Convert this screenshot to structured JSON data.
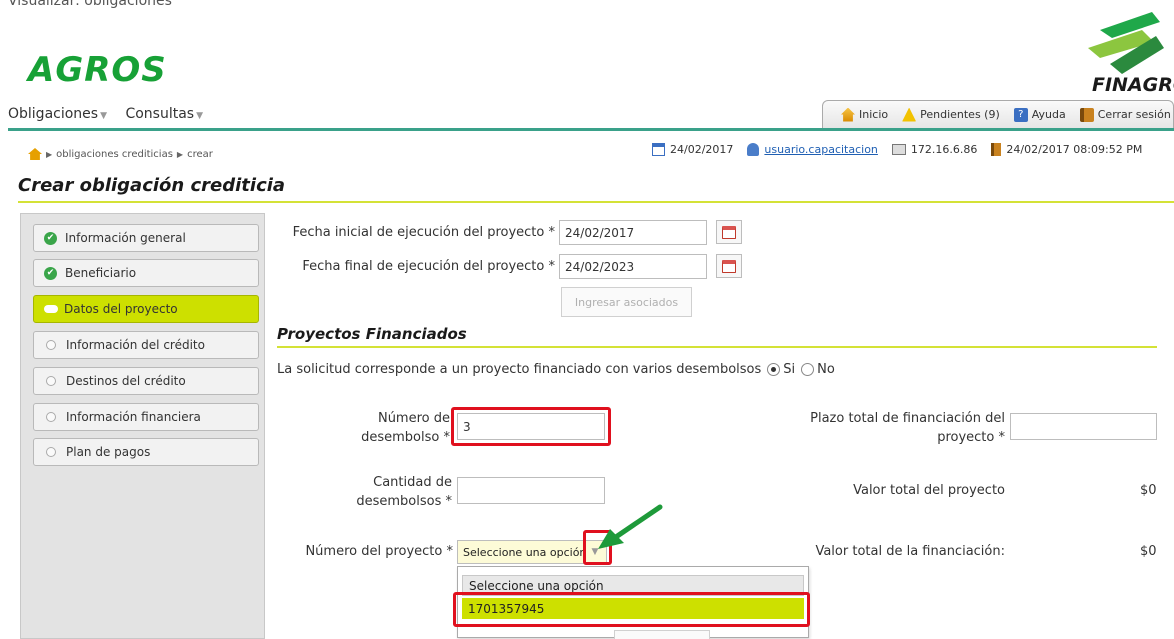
{
  "top_cut_text": "Visualizar: obligaciones",
  "brand": {
    "app_logo": "AGROS",
    "partner_logo": "FINAGRO"
  },
  "menu": {
    "items": [
      {
        "label": "Obligaciones"
      },
      {
        "label": "Consultas"
      }
    ]
  },
  "toolbar": {
    "items": [
      {
        "label": "Inicio",
        "icon": "home-icon",
        "color": "#e6a000"
      },
      {
        "label": "Pendientes (9)",
        "icon": "warning-icon",
        "color": "#f2c200"
      },
      {
        "label": "Ayuda",
        "icon": "help-icon",
        "color": "#3b6fc2"
      },
      {
        "label": "Cerrar sesión",
        "icon": "door-icon",
        "color": "#c9821f"
      }
    ]
  },
  "breadcrumb": {
    "items": [
      "obligaciones crediticias",
      "crear"
    ]
  },
  "status": {
    "date": "24/02/2017",
    "user": "usuario.capacitacion",
    "ip": "172.16.6.86",
    "datetime": "24/02/2017 08:09:52 PM"
  },
  "page_title": "Crear obligación crediticia",
  "sidebar": {
    "items": [
      {
        "label": "Información general",
        "state": "done"
      },
      {
        "label": "Beneficiario",
        "state": "done"
      },
      {
        "label": "Datos del proyecto",
        "state": "active"
      },
      {
        "label": "Información del crédito",
        "state": "pending"
      },
      {
        "label": "Destinos del crédito",
        "state": "pending"
      },
      {
        "label": "Información financiera",
        "state": "pending"
      },
      {
        "label": "Plan de pagos",
        "state": "pending"
      }
    ]
  },
  "form": {
    "fecha_inicial_label": "Fecha inicial de ejecución del proyecto *",
    "fecha_inicial_value": "24/02/2017",
    "fecha_final_label": "Fecha final de ejecución del proyecto *",
    "fecha_final_value": "24/02/2023",
    "ingresar_asociados": "Ingresar asociados",
    "section_title": "Proyectos Financiados",
    "varios_label": "La solicitud corresponde a un proyecto financiado con varios desembolsos",
    "opt_si": "Si",
    "opt_no": "No",
    "num_desembolso_label_1": "Número de",
    "num_desembolso_label_2": "desembolso *",
    "num_desembolso_value": "3",
    "cantidad_label_1": "Cantidad de",
    "cantidad_label_2": "desembolsos *",
    "cantidad_value": "",
    "num_proyecto_label": "Número del proyecto *",
    "num_proyecto_selected": "Seleccione una opción",
    "plazo_label_1": "Plazo total de financiación del",
    "plazo_label_2": "proyecto *",
    "plazo_value": "",
    "valor_proyecto_label": "Valor total del proyecto",
    "valor_proyecto_value": "$0",
    "valor_financiacion_label": "Valor total de la financiación:",
    "valor_financiacion_value": "$0",
    "dropdown_options": [
      "Seleccione una opción",
      "1701357945"
    ]
  },
  "colors": {
    "accent_green": "#17a136",
    "active_lime": "#cde000",
    "highlight_red": "#e0101e",
    "arrow_green": "#1e9a3a"
  }
}
